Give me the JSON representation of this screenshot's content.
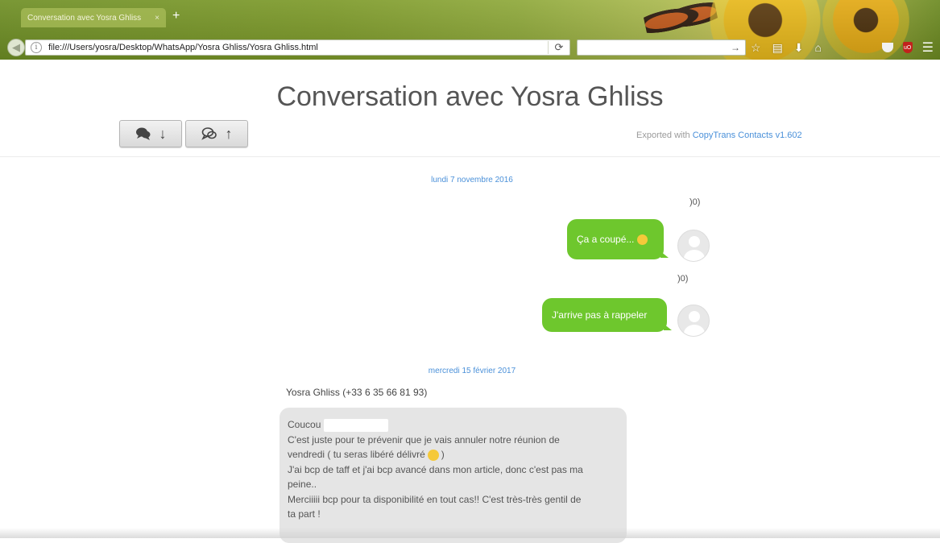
{
  "browser": {
    "tab_title": "Conversation avec Yosra Ghliss",
    "tab_close": "×",
    "new_tab": "+",
    "url": "file:///Users/yosra/Desktop/WhatsApp/Yosra Ghliss/Yosra Ghliss.html",
    "icons": [
      "back-icon",
      "info-icon",
      "reload-icon",
      "search-go-icon",
      "star-icon",
      "reading-list-icon",
      "download-icon",
      "home-icon",
      "pocket-icon",
      "ublock-icon",
      "menu-icon"
    ]
  },
  "page": {
    "title": "Conversation avec Yosra Ghliss",
    "export_prefix": "Exported with ",
    "export_link": "CopyTrans Contacts v1.602"
  },
  "messages": {
    "day1": "lundi 7 novembre 2016",
    "out1_sender_clip": ")0)",
    "out1_text": "Ça a coupé...",
    "out2_sender_clip": ")0)",
    "out2_text": "J'arrive pas à rappeler",
    "day2": "mercredi 15 février 2017",
    "in_sender": "Yosra Ghliss (+33 6 35 66 81 93)",
    "in_lines": {
      "l1": "Coucou",
      "l2": "C'est juste pour te prévenir que je vais annuler notre réunion de",
      "l3a": "vendredi  ( tu seras libéré délivré",
      "l3b": ")",
      "l4": "J'ai bcp de taff et j'ai bcp avancé dans mon article, donc c'est pas ma",
      "l5": "peine..",
      "l6": "Merciiiii bcp pour ta disponibilité en tout cas!! C'est très-très gentil de",
      "l7": "ta part !"
    }
  },
  "colors": {
    "outgoing_bubble": "#6ec72d",
    "incoming_bubble": "#e5e5e5",
    "link": "#4a90d9"
  }
}
